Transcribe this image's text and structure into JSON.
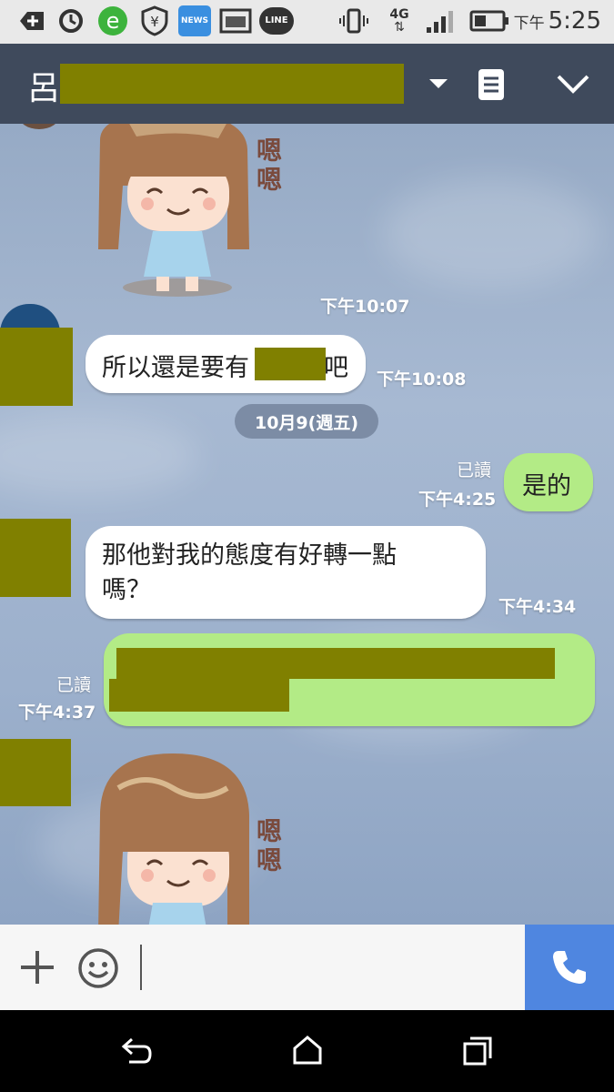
{
  "status_bar": {
    "news_label": "NEWS",
    "line_label": "LINE",
    "network": "4G",
    "clock_prefix": "下午",
    "clock_time": "5:25"
  },
  "header": {
    "contact_name_visible": "呂"
  },
  "messages": {
    "m1_time": "下午10:07",
    "m2_text": "所以還是要有",
    "m2_text_end": "吧",
    "m2_time": "下午10:08",
    "date_divider": "10月9(週五)",
    "m3_read": "已讀",
    "m3_time": "下午4:25",
    "m3_text": "是的",
    "m4_text_line1": "那他對我的態度有好轉一點",
    "m4_text_line2": "嗎？",
    "m4_time": "下午4:34",
    "m5_read": "已讀",
    "m5_time": "下午4:37"
  },
  "sticker_text": "嗯嗯"
}
